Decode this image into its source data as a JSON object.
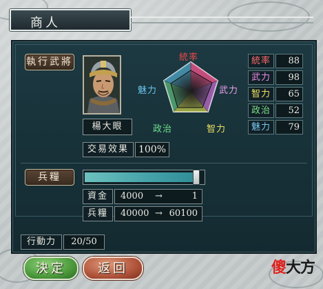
{
  "window": {
    "title": "商人"
  },
  "general": {
    "tag_label": "執行武將",
    "name": "楊大眼",
    "portrait_icon": "general-portrait"
  },
  "radar": {
    "labels": {
      "top": "統率",
      "left": "魅力",
      "right": "武力",
      "bottom_left": "政治",
      "bottom_right": "智力"
    },
    "colors": {
      "統率": "#e84a4a",
      "武力": "#e8a0e8",
      "智力": "#e8e060",
      "政治": "#6ee08a",
      "魅力": "#6ac6f0"
    }
  },
  "stats": [
    {
      "name": "統率",
      "value": "88",
      "color": "#ff6a6a"
    },
    {
      "name": "武力",
      "value": "98",
      "color": "#e88ee8"
    },
    {
      "name": "智力",
      "value": "65",
      "color": "#f0e060"
    },
    {
      "name": "政治",
      "value": "52",
      "color": "#7ee08a"
    },
    {
      "name": "魅力",
      "value": "79",
      "color": "#7ac8f2"
    }
  ],
  "trade": {
    "effect_label": "交易效果",
    "effect_value": "100%"
  },
  "goods": {
    "tag_label": "兵糧",
    "slider_fraction": 0.98
  },
  "funds": {
    "label": "資金",
    "from": "4000",
    "arrow": "→",
    "to": "1"
  },
  "provisions": {
    "label": "兵糧",
    "from": "40000",
    "arrow": "→",
    "to": "60100"
  },
  "action_points": {
    "label": "行動力",
    "value": "20/50"
  },
  "buttons": {
    "ok": "決定",
    "back": "返回"
  },
  "watermark": {
    "part1": "傻",
    "part2": "大方",
    "color1": "#e0221e",
    "color2": "#1a1a1a"
  }
}
